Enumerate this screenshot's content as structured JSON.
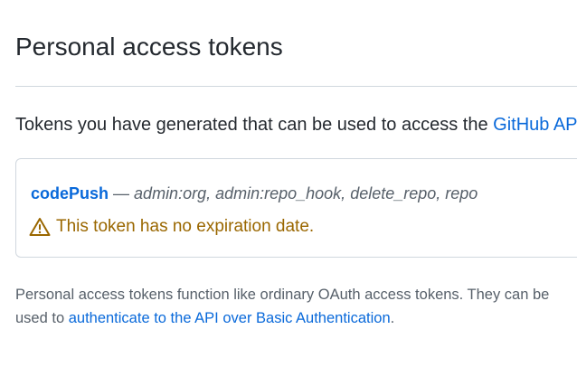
{
  "page": {
    "title": "Personal access tokens"
  },
  "intro": {
    "text": "Tokens you have generated that can be used to access the ",
    "link_text": "GitHub API"
  },
  "token": {
    "name": "codePush",
    "separator": " — ",
    "scopes": "admin:org, admin:repo_hook, delete_repo, repo",
    "warning_icon": "alert-icon",
    "warning": "This token has no expiration date."
  },
  "footer": {
    "line1": "Personal access tokens function like ordinary OAuth access tokens. They can be",
    "line2_prefix": "used to ",
    "line2_link": "authenticate to the API over Basic Authentication",
    "line2_suffix": "."
  },
  "colors": {
    "link": "#0969da",
    "warning": "#9a6700",
    "muted": "#57606a",
    "border": "#d0d7de"
  }
}
